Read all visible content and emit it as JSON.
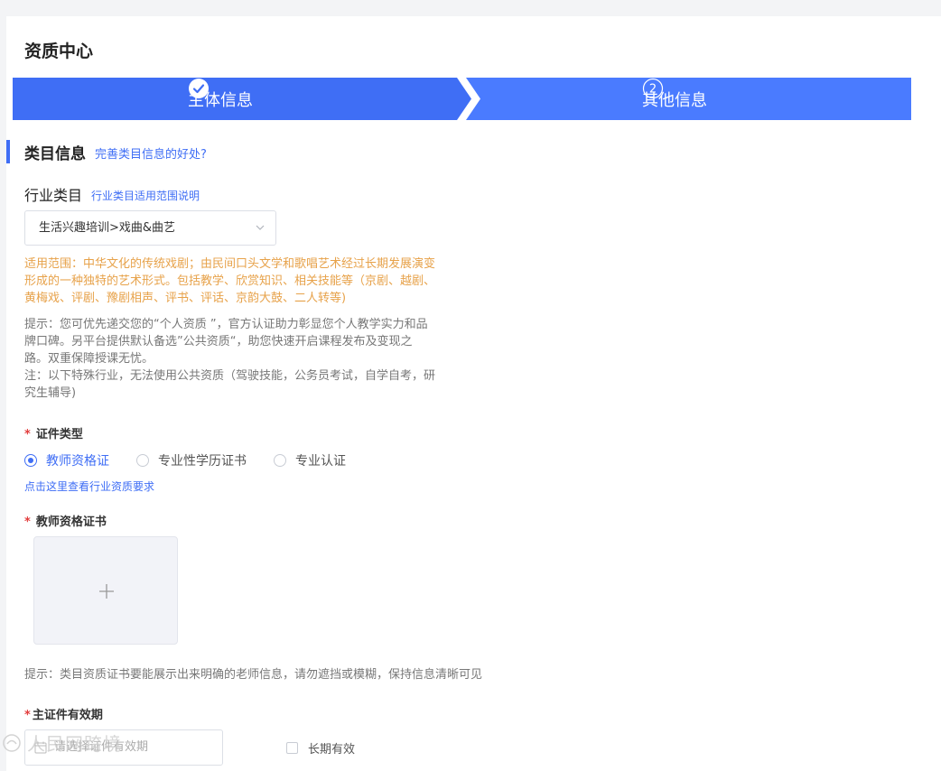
{
  "page": {
    "title": "资质中心"
  },
  "steps": [
    {
      "label": "主体信息",
      "status": "done"
    },
    {
      "label": "其他信息",
      "number": "2"
    }
  ],
  "section": {
    "title": "类目信息",
    "link": "完善类目信息的好处?"
  },
  "industry": {
    "label": "行业类目",
    "link": "行业类目适用范围说明",
    "selected": "生活兴趣培训>戏曲&曲艺",
    "scope_lines": [
      "适用范围：中华文化的传统戏剧；由民间口头文学和歌唱艺术经过长期发展演变",
      "形成的一种独特的艺术形式。包括教学、欣赏知识、相关技能等（京剧、越剧、",
      "黄梅戏、评剧、豫剧相声、评书、评话、京韵大鼓、二人转等)"
    ],
    "tip_lines": [
      "提示：您可优先递交您的“个人资质 ”，官方认证助力彰显您个人教学实力和品",
      "牌口碑。另平台提供默认备选”公共资质“，助您快速开启课程发布及变现之",
      "路。双重保障授课无忧。",
      "注：以下特殊行业，无法使用公共资质（驾驶技能，公务员考试，自学自考，研",
      "究生辅导)"
    ]
  },
  "cert_type": {
    "label": "证件类型",
    "options": [
      {
        "label": "教师资格证",
        "checked": true
      },
      {
        "label": "专业性学历证书",
        "checked": false
      },
      {
        "label": "专业认证",
        "checked": false
      }
    ],
    "link": "点击这里查看行业资质要求"
  },
  "teacher_cert": {
    "label": "教师资格证书",
    "tip": "提示：类目资质证书要能展示出来明确的老师信息，请勿遮挡或模糊，保持信息清晰可见"
  },
  "validity": {
    "label": "主证件有效期",
    "placeholder": "请选择证件有效期",
    "long_term": "长期有效"
  },
  "watermark": {
    "text": "人民网跨境"
  },
  "colors": {
    "primary": "#3f6ef5",
    "warning": "#e7a24a",
    "required": "#e23c3c"
  }
}
